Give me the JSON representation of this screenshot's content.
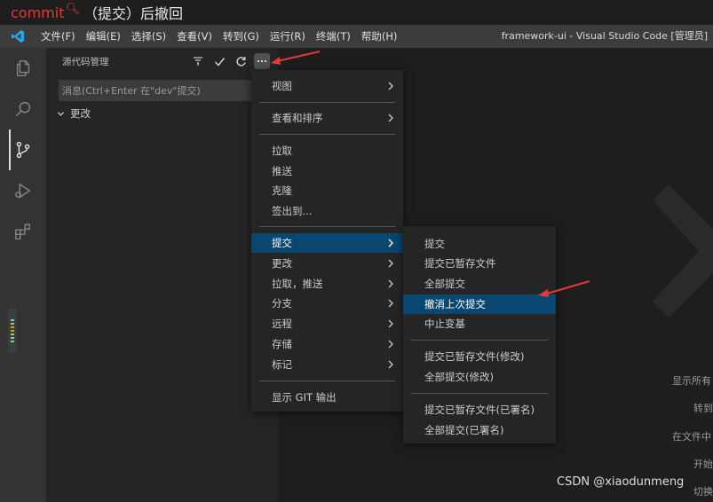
{
  "caption": {
    "keyword": "commit",
    "text": "（提交）后撤回"
  },
  "titlebar": {
    "menus": [
      "文件(F)",
      "编辑(E)",
      "选择(S)",
      "查看(V)",
      "转到(G)",
      "运行(R)",
      "终端(T)",
      "帮助(H)"
    ],
    "window_title": "framework-ui - Visual Studio Code [管理员]"
  },
  "activity_icons": [
    "explorer-icon",
    "search-icon",
    "source-control-icon",
    "run-debug-icon",
    "extensions-icon"
  ],
  "sidebar": {
    "header": "源代码管理",
    "message_placeholder": "消息(Ctrl+Enter 在\"dev\"提交)",
    "changes_label": "更改"
  },
  "menu_main": {
    "items": [
      {
        "label": "视图",
        "submenu": true
      },
      {
        "label": "查看和排序",
        "submenu": true
      },
      {
        "label": "拉取",
        "submenu": false
      },
      {
        "label": "推送",
        "submenu": false
      },
      {
        "label": "克隆",
        "submenu": false
      },
      {
        "label": "签出到...",
        "submenu": false
      },
      {
        "label": "提交",
        "submenu": true,
        "selected": true
      },
      {
        "label": "更改",
        "submenu": true
      },
      {
        "label": "拉取，推送",
        "submenu": true
      },
      {
        "label": "分支",
        "submenu": true
      },
      {
        "label": "远程",
        "submenu": true
      },
      {
        "label": "存储",
        "submenu": true
      },
      {
        "label": "标记",
        "submenu": true
      },
      {
        "label": "显示 GIT 输出",
        "submenu": false
      }
    ]
  },
  "menu_commit": {
    "items": [
      {
        "label": "提交"
      },
      {
        "label": "提交已暂存文件"
      },
      {
        "label": "全部提交"
      },
      {
        "label": "撤消上次提交",
        "selected": true
      },
      {
        "label": "中止变基"
      },
      {
        "label": "提交已暂存文件(修改)"
      },
      {
        "label": "全部提交(修改)"
      },
      {
        "label": "提交已暂存文件(已署名)"
      },
      {
        "label": "全部提交(已署名)"
      }
    ]
  },
  "editor_hints": [
    "显示所有",
    "转到",
    "在文件中",
    "开始",
    "切换"
  ],
  "watermark": "CSDN @xiaodunmeng",
  "colors": {
    "accent_selected": "#094771",
    "annotation_red": "#e23a3a",
    "vscode_blue": "#23a9f2"
  }
}
